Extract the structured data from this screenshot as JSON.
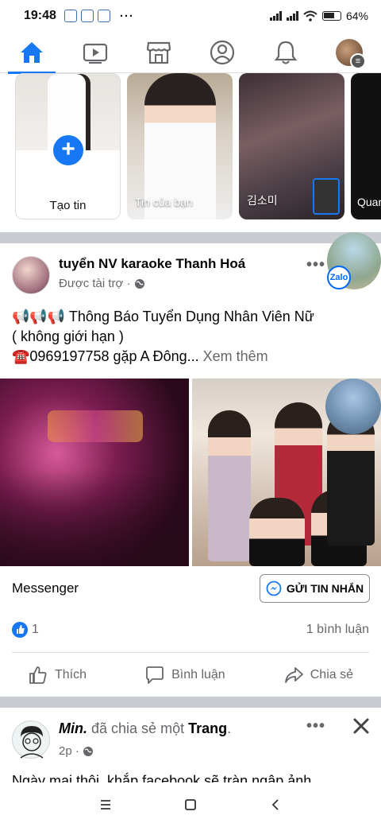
{
  "status_bar": {
    "time": "19:48",
    "more": "···",
    "battery": "64%"
  },
  "nav": {
    "tabs": [
      "home-icon",
      "watch-icon",
      "marketplace-icon",
      "profile-icon",
      "bell-icon",
      "menu-avatar"
    ],
    "accent": "#1877f2"
  },
  "stories": {
    "create_label": "Tạo tin",
    "items": [
      {
        "name": "Tin của bạn"
      },
      {
        "name": "김소미"
      },
      {
        "name": "Quan"
      }
    ]
  },
  "post": {
    "page_name": "tuyển NV karaoke Thanh Hoá",
    "sponsored": "Được tài trợ ·",
    "badge": "Zalo",
    "text_line1": "📢📢📢  Thông Báo Tuyển Dụng Nhân Viên Nữ",
    "text_line2": "( không giới hạn )",
    "text_line3": "☎️0969197758 gặp A Đông...",
    "see_more": "Xem thêm",
    "cta_label": "Messenger",
    "cta_button": "GỬI TIN NHẮN",
    "like_count": "1",
    "comment_count": "1 bình luận",
    "actions": {
      "like": "Thích",
      "comment": "Bình luận",
      "share": "Chia sẻ"
    }
  },
  "post2": {
    "author": "Min.",
    "verb": "đã chia sẻ một",
    "target": "Trang",
    "period": ".",
    "time": "2p ·",
    "preview": "Ngày mai thôi, khắp facebook sẽ tràn ngập ảnh"
  }
}
